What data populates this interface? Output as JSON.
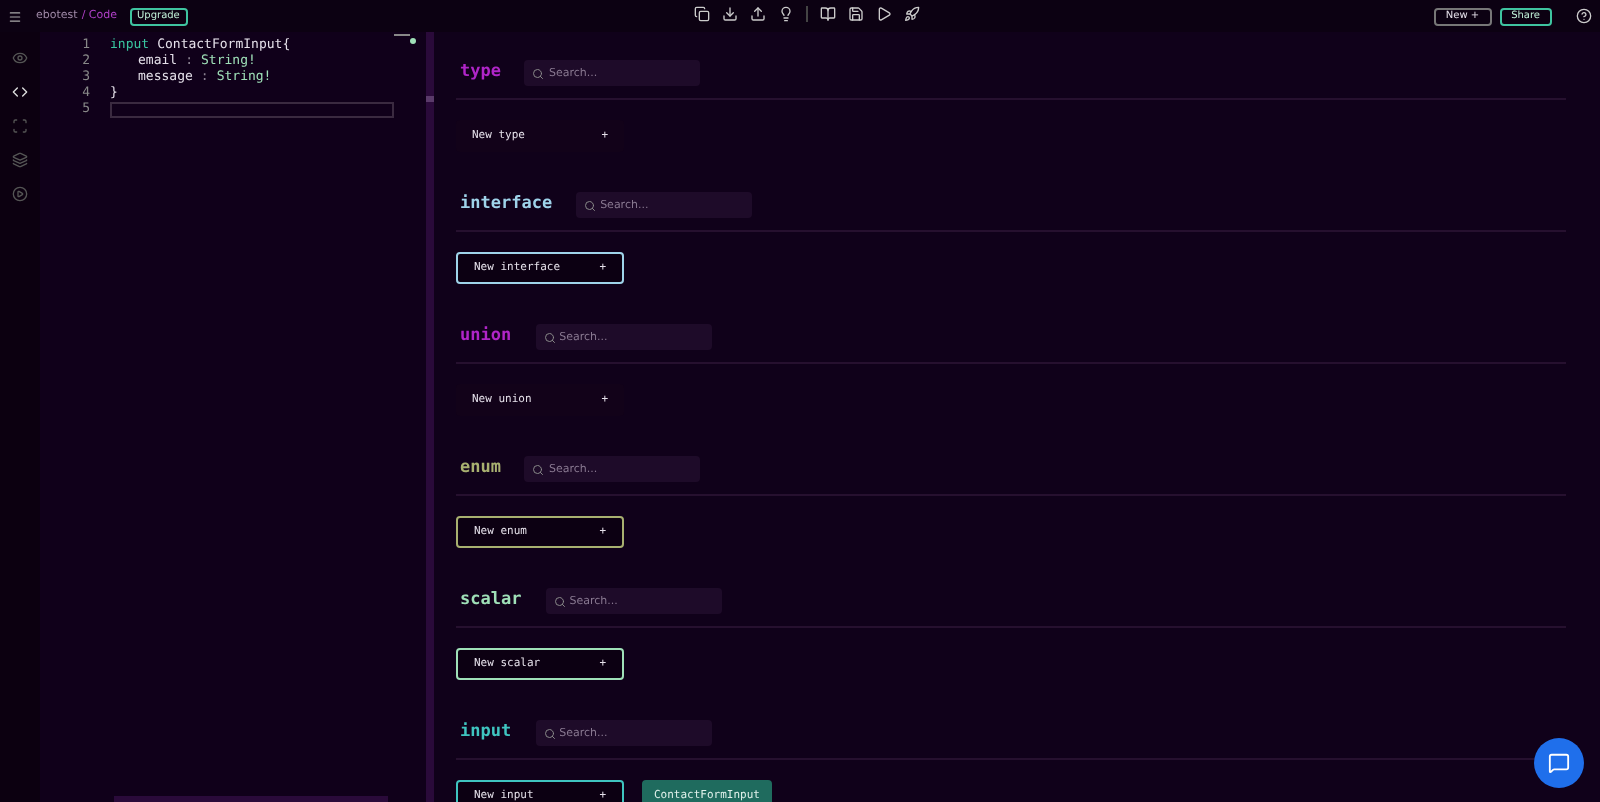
{
  "topbar": {
    "project": "ebotest",
    "page": "/ Code",
    "upgrade": "Upgrade",
    "new_button": "New +",
    "share": "Share"
  },
  "rail": [
    {
      "selected": false
    },
    {
      "selected": true
    },
    {
      "selected": false
    },
    {
      "selected": false
    },
    {
      "selected": false
    }
  ],
  "editor": {
    "lines": [
      {
        "number": "1",
        "current": false,
        "tokens": [
          {
            "kind": "keyword",
            "text": "input"
          },
          {
            "kind": "name",
            "text": "ContactFormInput{"
          }
        ]
      },
      {
        "number": "2",
        "current": false,
        "tokens": [
          {
            "kind": "field",
            "text": "email"
          },
          {
            "kind": "punct",
            "text": ":"
          },
          {
            "kind": "type",
            "text": "String!"
          }
        ]
      },
      {
        "number": "3",
        "current": false,
        "tokens": [
          {
            "kind": "field",
            "text": "message"
          },
          {
            "kind": "punct",
            "text": ":"
          },
          {
            "kind": "type",
            "text": "String!"
          }
        ]
      },
      {
        "number": "4",
        "current": false,
        "tokens": [
          {
            "kind": "name",
            "text": "}"
          }
        ]
      },
      {
        "number": "5",
        "current": true
      }
    ]
  },
  "sections": [
    {
      "title": "type",
      "color": "#b025c8",
      "placeholder": "Search...",
      "button": "New type",
      "plus": "+",
      "outlined": false
    },
    {
      "title": "interface",
      "color": "#9fd3ea",
      "placeholder": "Search...",
      "button": "New interface",
      "plus": "+",
      "outlined": true
    },
    {
      "title": "union",
      "color": "#b025c8",
      "placeholder": "Search...",
      "button": "New union",
      "plus": "+",
      "outlined": false
    },
    {
      "title": "enum",
      "color": "#a8b070",
      "placeholder": "Search...",
      "button": "New enum",
      "plus": "+",
      "outlined": true
    },
    {
      "title": "scalar",
      "color": "#9fe0b8",
      "placeholder": "Search...",
      "button": "New scalar",
      "plus": "+",
      "outlined": true
    },
    {
      "title": "input",
      "color": "#3fc4c0",
      "placeholder": "Search...",
      "button": "New input",
      "plus": "+",
      "outlined": true,
      "items": [
        "ContactFormInput"
      ]
    }
  ]
}
